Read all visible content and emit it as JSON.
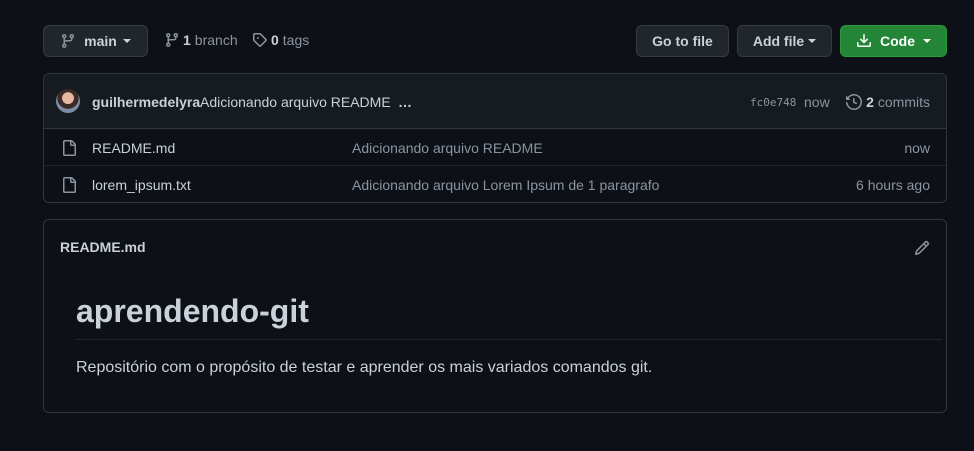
{
  "branch_select": {
    "label": "main"
  },
  "branches": {
    "count": "1",
    "label": "branch"
  },
  "tags": {
    "count": "0",
    "label": "tags"
  },
  "actions": {
    "goto_file": "Go to file",
    "add_file": "Add file",
    "code": "Code"
  },
  "latest_commit": {
    "author": "guilhermedelyra",
    "message": "Adicionando arquivo README",
    "ellipsis": "…",
    "hash": "fc0e748",
    "time": "now",
    "commits_count": "2",
    "commits_label": "commits"
  },
  "files": [
    {
      "name": "README.md",
      "message": "Adicionando arquivo README",
      "time": "now"
    },
    {
      "name": "lorem_ipsum.txt",
      "message": "Adicionando arquivo Lorem Ipsum de 1 paragrafo",
      "time": "6 hours ago"
    }
  ],
  "readme": {
    "filename": "README.md",
    "heading": "aprendendo-git",
    "body": "Repositório com o propósito de testar e aprender os mais variados comandos git."
  },
  "colors": {
    "background": "#0d1117",
    "code_button": "#238636",
    "border": "#30363d",
    "muted_text": "#8b949e"
  },
  "icons": [
    "git-branch-icon",
    "tag-icon",
    "download-icon",
    "history-icon",
    "file-icon",
    "pencil-icon"
  ]
}
